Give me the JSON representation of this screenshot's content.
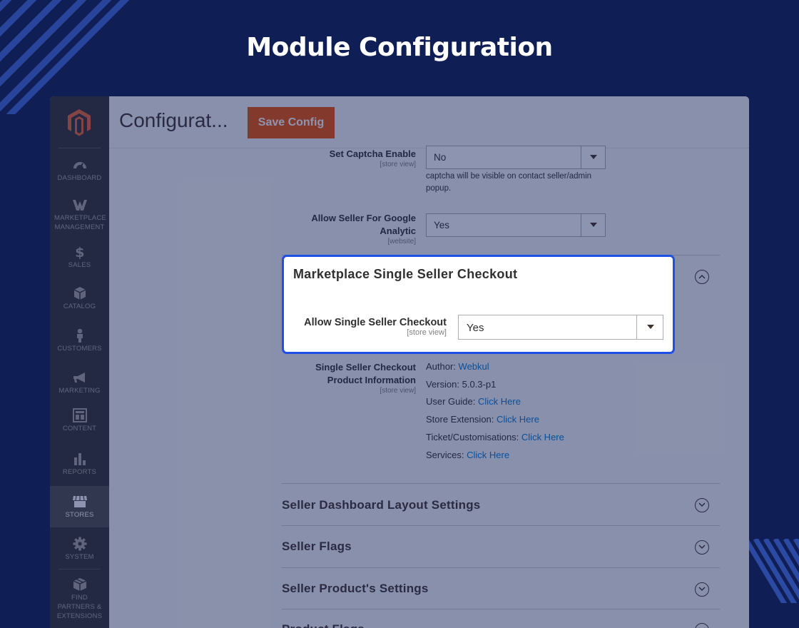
{
  "banner": {
    "title": "Module Configuration"
  },
  "sidebar": {
    "items": [
      {
        "label": "DASHBOARD",
        "icon": "dashboard-icon"
      },
      {
        "label": "MARKETPLACE MANAGEMENT",
        "icon": "marketplace-icon"
      },
      {
        "label": "SALES",
        "icon": "dollar-icon"
      },
      {
        "label": "CATALOG",
        "icon": "box-icon"
      },
      {
        "label": "CUSTOMERS",
        "icon": "person-icon"
      },
      {
        "label": "MARKETING",
        "icon": "megaphone-icon"
      },
      {
        "label": "CONTENT",
        "icon": "layout-icon"
      },
      {
        "label": "REPORTS",
        "icon": "bar-chart-icon"
      },
      {
        "label": "STORES",
        "icon": "store-icon",
        "active": true
      },
      {
        "label": "SYSTEM",
        "icon": "gear-icon"
      },
      {
        "label": "FIND PARTNERS & EXTENSIONS",
        "icon": "package-icon"
      }
    ]
  },
  "header": {
    "title": "Configurat...",
    "save_label": "Save Config"
  },
  "fields": {
    "captcha": {
      "label": "Set Captcha Enable",
      "scope": "[store view]",
      "value": "No",
      "note": "captcha will be visible on contact seller/admin popup."
    },
    "analytics": {
      "label": "Allow Seller For Google Analytic",
      "scope": "[website]",
      "value": "Yes"
    }
  },
  "popup": {
    "title": "Marketplace Single Seller Checkout",
    "field_label": "Allow Single Seller Checkout",
    "scope": "[store view]",
    "value": "Yes"
  },
  "product_info": {
    "label": "Single Seller Checkout Product Information",
    "scope": "[store view]",
    "author_label": "Author:",
    "author_link": "Webkul",
    "version_label": "Version:",
    "version": "5.0.3-p1",
    "guide_label": "User Guide:",
    "guide_link": "Click Here",
    "store_label": "Store Extension:",
    "store_link": "Click Here",
    "ticket_label": "Ticket/Customisations:",
    "ticket_link": "Click Here",
    "services_label": "Services:",
    "services_link": "Click Here"
  },
  "sections": [
    {
      "title": "Seller Dashboard Layout Settings"
    },
    {
      "title": "Seller Flags"
    },
    {
      "title": "Seller Product's Settings"
    },
    {
      "title": "Product Flags"
    }
  ],
  "colors": {
    "background": "#0f1f55",
    "highlight_border": "#1f50e6",
    "save_button": "#eb5202",
    "link": "#007bdb"
  }
}
